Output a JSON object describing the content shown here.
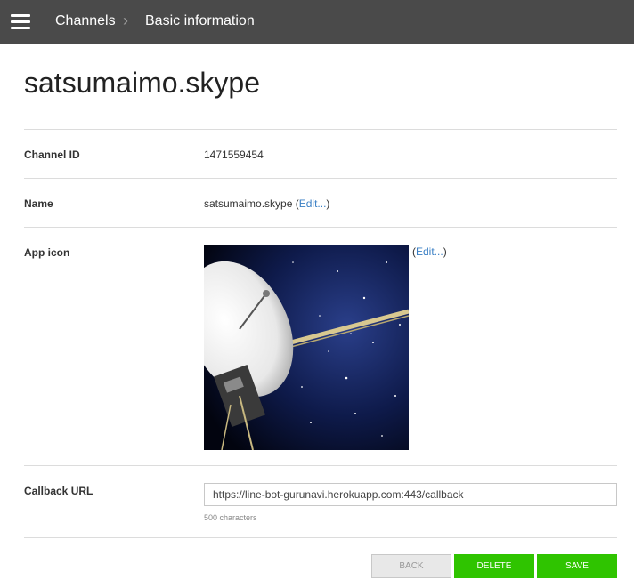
{
  "header": {
    "breadcrumb": [
      "Channels",
      "Basic information"
    ],
    "separator": ">"
  },
  "page_title": "satsumaimo.skype",
  "rows": {
    "channel_id": {
      "label": "Channel ID",
      "value": "1471559454"
    },
    "name": {
      "label": "Name",
      "value": "satsumaimo.skype",
      "edit_label": "Edit..."
    },
    "app_icon": {
      "label": "App icon",
      "edit_label": "Edit...",
      "image": "satellite-dish-space-photo"
    },
    "callback_url": {
      "label": "Callback URL",
      "value": "https://line-bot-gurunavi.herokuapp.com:443/callback",
      "note": "500 characters"
    }
  },
  "buttons": {
    "back": "BACK",
    "delete": "DELETE",
    "save": "SAVE"
  },
  "colors": {
    "header_bg": "#4a4a4a",
    "link": "#3a7fc4",
    "primary": "#2fc400"
  }
}
